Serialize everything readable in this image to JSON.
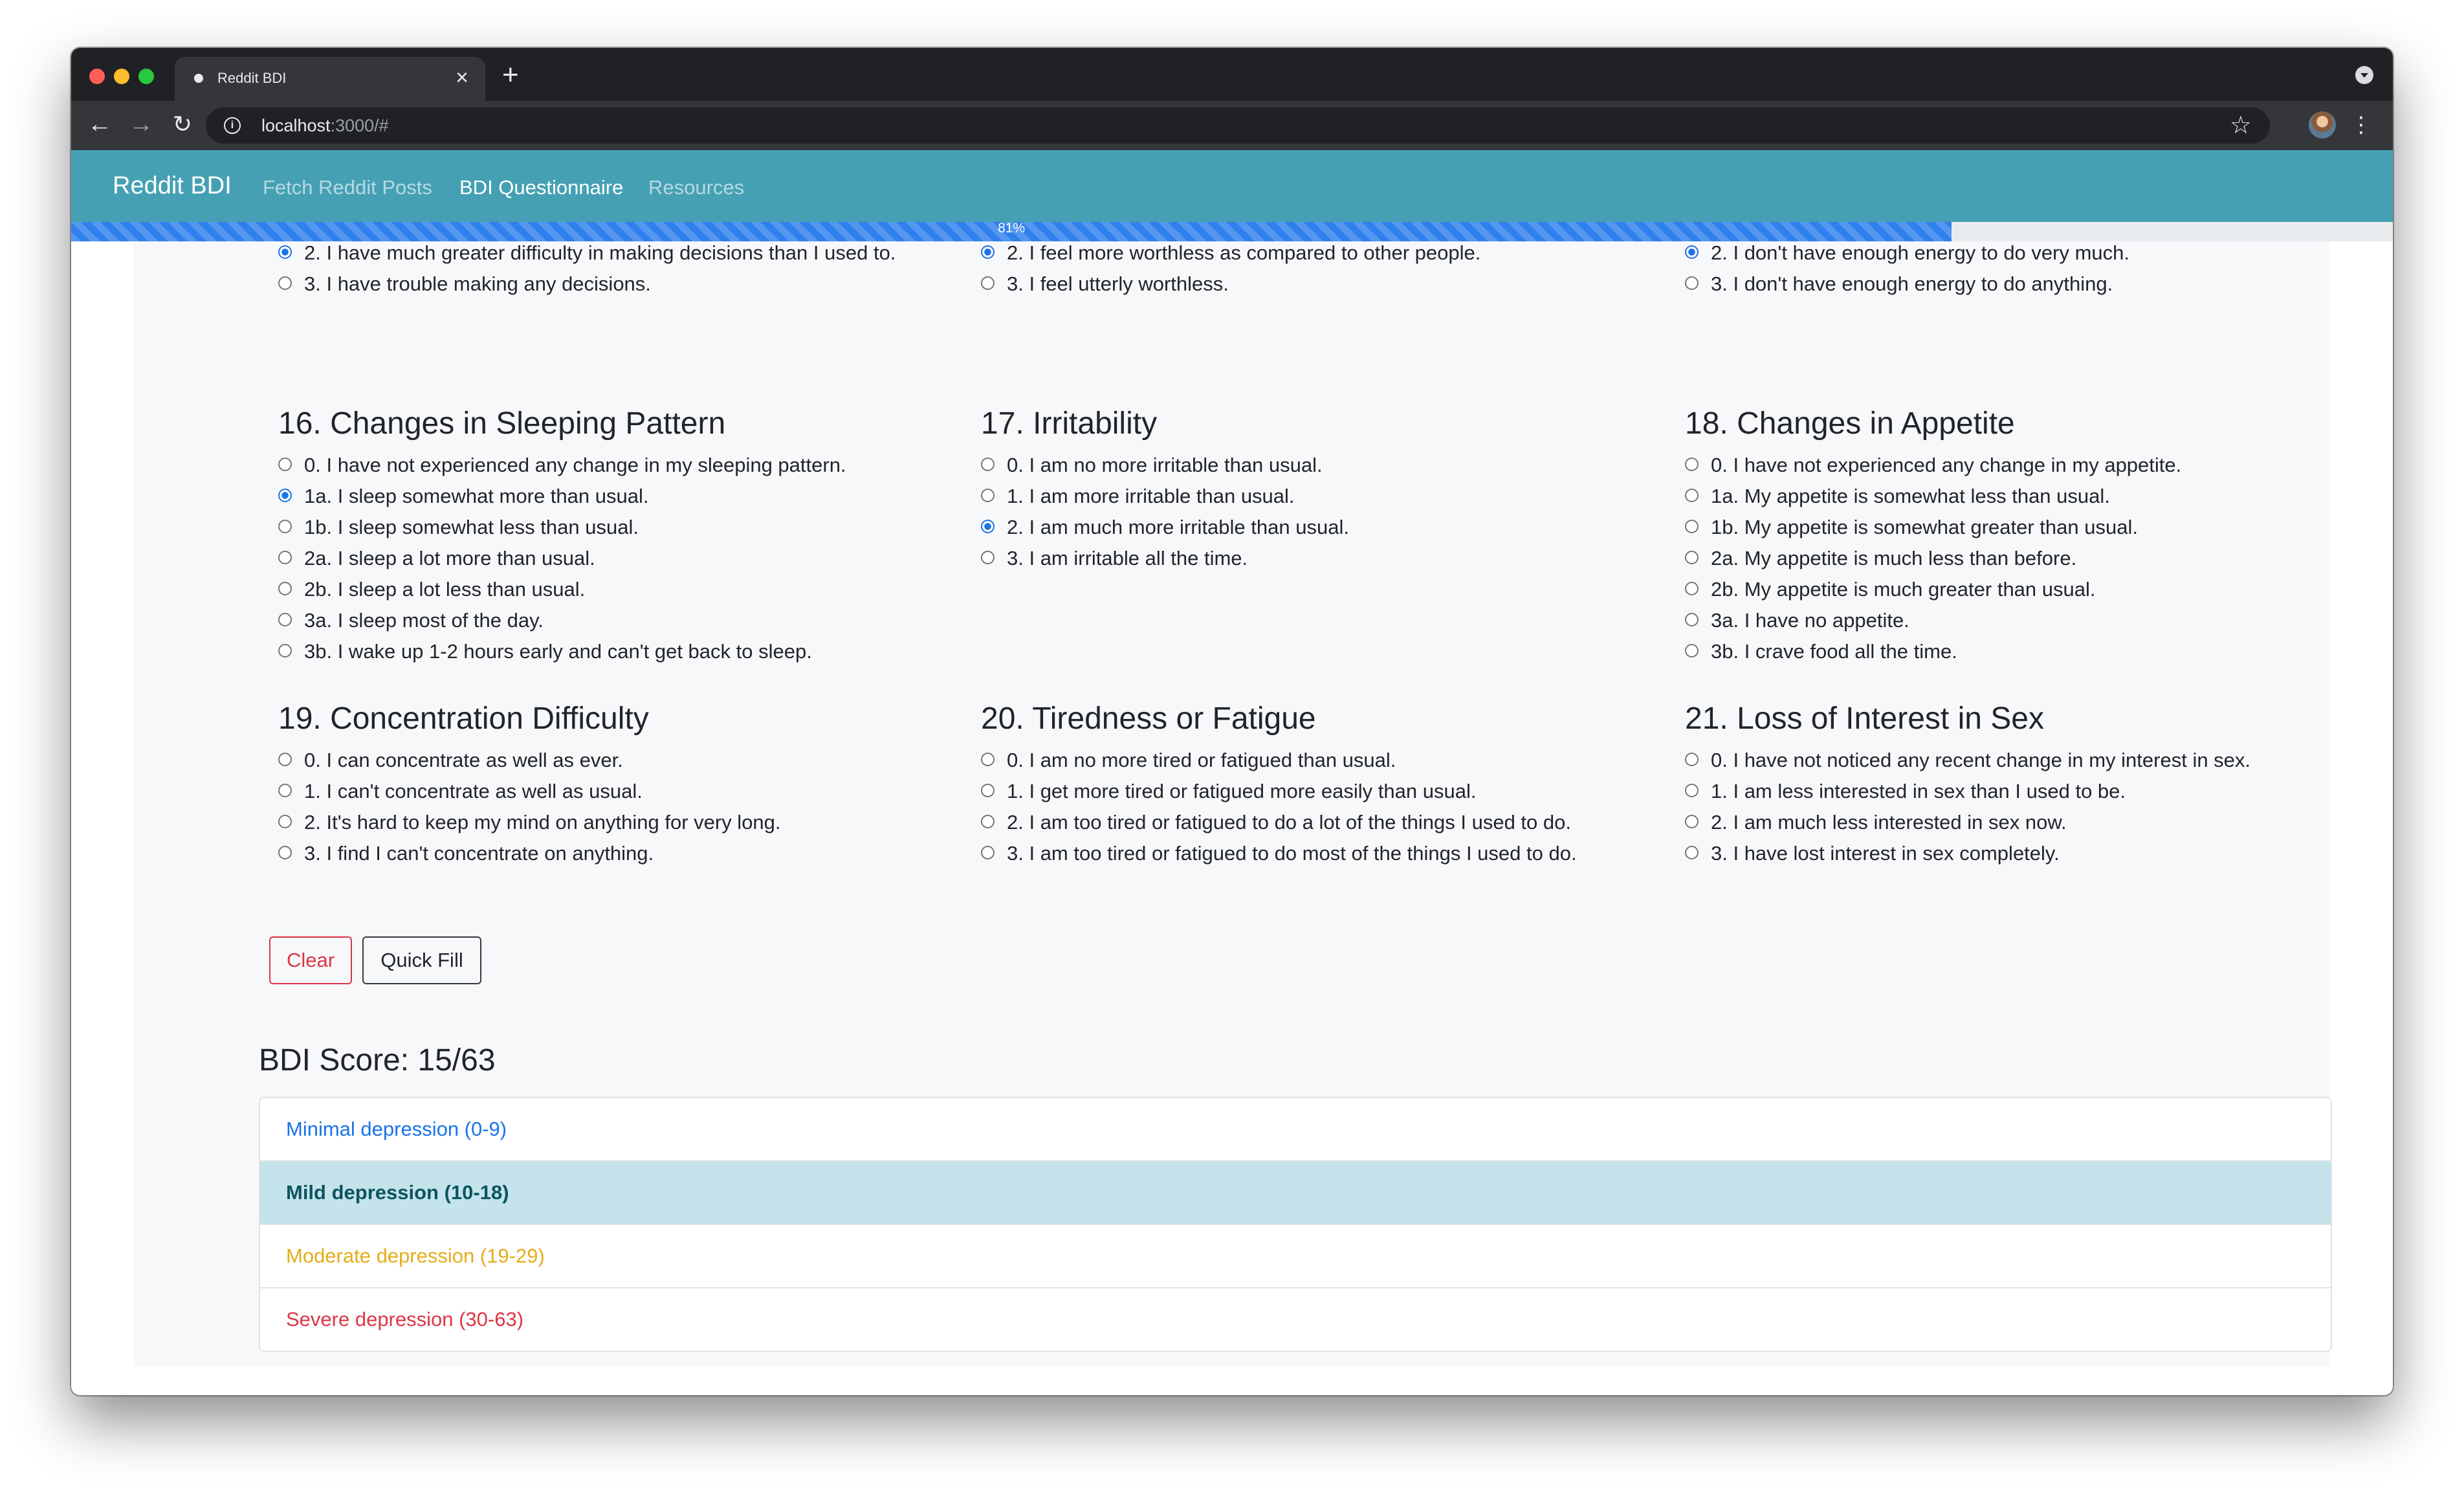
{
  "browser": {
    "tab_title": "Reddit BDI",
    "url_host": "localhost",
    "url_rest": ":3000/#"
  },
  "navbar": {
    "brand": "Reddit BDI",
    "links": [
      "Fetch Reddit Posts",
      "BDI Questionnaire",
      "Resources"
    ],
    "active_link": "BDI Questionnaire",
    "color": "#46a0b4"
  },
  "progress": {
    "label": "81%",
    "value": 81
  },
  "questions_partial": [
    {
      "options": [
        "2. I have much greater difficulty in making decisions than I used to.",
        "3. I have trouble making any decisions."
      ],
      "selected": 0
    },
    {
      "options": [
        "2. I feel more worthless as compared to other people.",
        "3. I feel utterly worthless."
      ],
      "selected": 0
    },
    {
      "options": [
        "2. I don't have enough energy to do very much.",
        "3. I don't have enough energy to do anything."
      ],
      "selected": 0
    }
  ],
  "questions": [
    {
      "title": "16. Changes in Sleeping Pattern",
      "options": [
        "0. I have not experienced any change in my sleeping pattern.",
        "1a. I sleep somewhat more than usual.",
        "1b. I sleep somewhat less than usual.",
        "2a. I sleep a lot more than usual.",
        "2b. I sleep a lot less than usual.",
        "3a. I sleep most of the day.",
        "3b. I wake up 1-2 hours early and can't get back to sleep."
      ],
      "selected": 1
    },
    {
      "title": "17. Irritability",
      "options": [
        "0. I am no more irritable than usual.",
        "1. I am more irritable than usual.",
        "2. I am much more irritable than usual.",
        "3. I am irritable all the time."
      ],
      "selected": 2
    },
    {
      "title": "18. Changes in Appetite",
      "options": [
        "0. I have not experienced any change in my appetite.",
        "1a. My appetite is somewhat less than usual.",
        "1b. My appetite is somewhat greater than usual.",
        "2a. My appetite is much less than before.",
        "2b. My appetite is much greater than usual.",
        "3a. I have no appetite.",
        "3b. I crave food all the time."
      ],
      "selected": -1
    },
    {
      "title": "19. Concentration Difficulty",
      "options": [
        "0. I can concentrate as well as ever.",
        "1. I can't concentrate as well as usual.",
        "2. It's hard to keep my mind on anything for very long.",
        "3. I find I can't concentrate on anything."
      ],
      "selected": -1
    },
    {
      "title": "20. Tiredness or Fatigue",
      "options": [
        "0. I am no more tired or fatigued than usual.",
        "1. I get more tired or fatigued more easily than usual.",
        "2. I am too tired or fatigued to do a lot of the things I used to do.",
        "3. I am too tired or fatigued to do most of the things I used to do."
      ],
      "selected": -1
    },
    {
      "title": "21. Loss of Interest in Sex",
      "options": [
        "0. I have not noticed any recent change in my interest in sex.",
        "1. I am less interested in sex than I used to be.",
        "2. I am much less interested in sex now.",
        "3. I have lost interest in sex completely."
      ],
      "selected": -1
    }
  ],
  "buttons": {
    "clear": "Clear",
    "quick_fill": "Quick Fill"
  },
  "score": {
    "label": "BDI Score: 15/63"
  },
  "levels": [
    {
      "label": "Minimal depression (0-9)",
      "color": "#1a73e8",
      "active": false
    },
    {
      "label": "Mild depression (10-18)",
      "color": "#0c5460",
      "active": true
    },
    {
      "label": "Moderate depression (19-29)",
      "color": "#e5ac1a",
      "active": false
    },
    {
      "label": "Severe depression (30-63)",
      "color": "#dc3545",
      "active": false
    }
  ]
}
